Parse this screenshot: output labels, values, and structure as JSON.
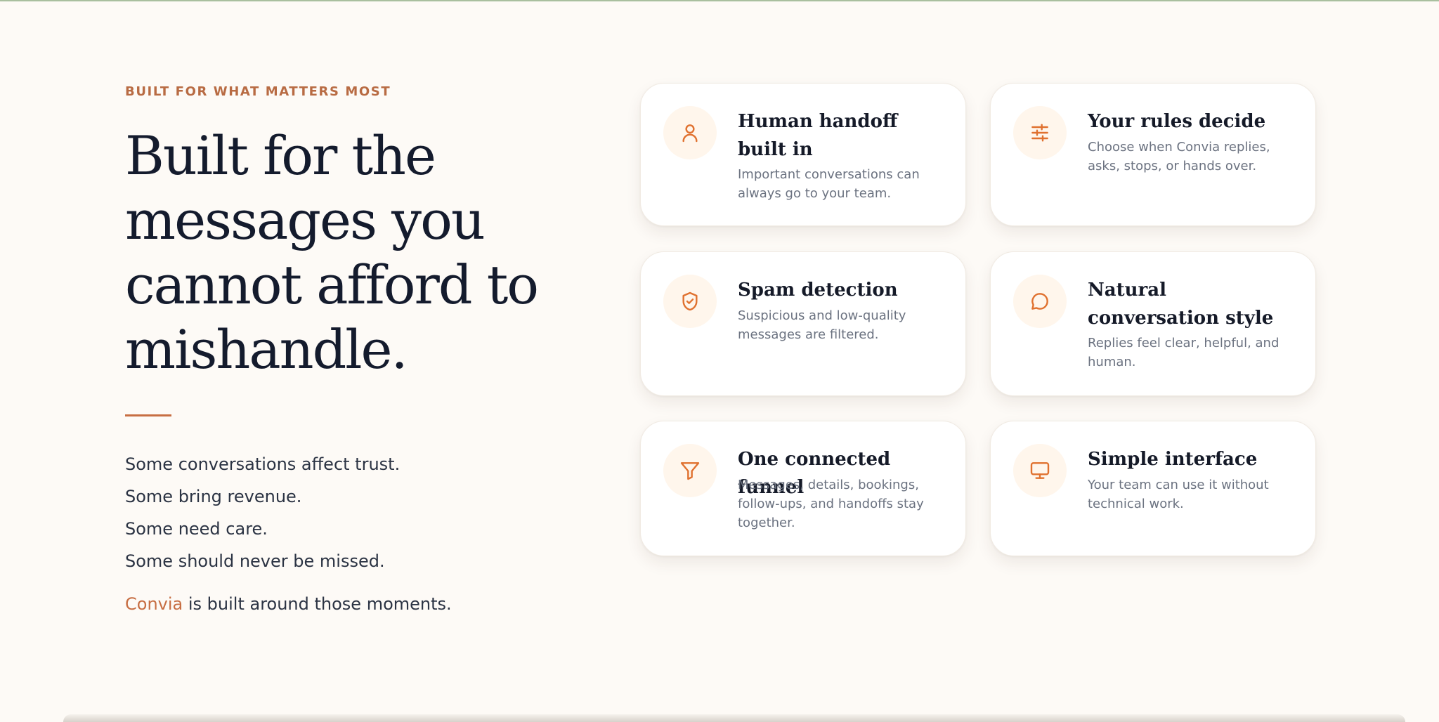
{
  "eyebrow": "BUILT FOR WHAT MATTERS MOST",
  "headline": "Built for the messages you cannot afford to mishandle.",
  "lines": [
    "Some conversations affect trust.",
    "Some bring revenue.",
    "Some need care.",
    "Some should never be missed."
  ],
  "closing": {
    "brand": "Convia",
    "text": " is built around those moments."
  },
  "colors": {
    "accent": "#c76e43",
    "icon": "#e0712f",
    "iconBg": "#fff6ec",
    "background": "#fdfaf6",
    "heading": "#141b2d"
  },
  "features": [
    {
      "icon": "user-icon",
      "title": "Human handoff built in",
      "desc": "Important conversations can always go to your team."
    },
    {
      "icon": "sliders-icon",
      "title": "Your rules decide",
      "desc": "Choose when Convia replies, asks, stops, or hands over."
    },
    {
      "icon": "shield-check-icon",
      "title": "Spam detection",
      "desc": "Suspicious and low-quality messages are filtered."
    },
    {
      "icon": "chat-bubble-icon",
      "title": "Natural conversation style",
      "desc": "Replies feel clear, helpful, and human."
    },
    {
      "icon": "funnel-icon",
      "title": "One connected funnel",
      "desc": "Messages, details, bookings, follow-ups, and handoffs stay together."
    },
    {
      "icon": "monitor-icon",
      "title": "Simple interface",
      "desc": "Your team can use it without technical work."
    }
  ]
}
